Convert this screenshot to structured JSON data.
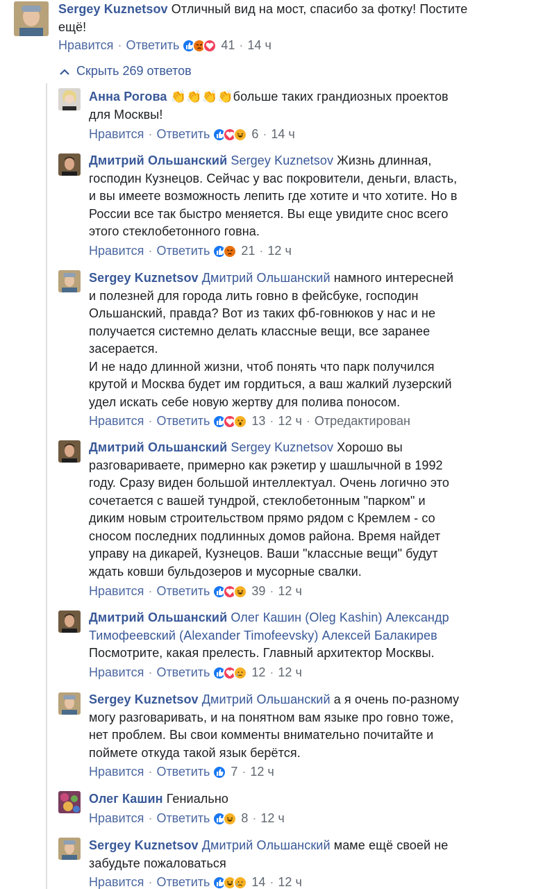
{
  "top_comment": {
    "author": "Sergey Kuznetsov",
    "lines": [
      "Отличный вид на мост, спасибо за фотку! Постите",
      "ещё!"
    ],
    "like_label": "Нравится",
    "reply_label": "Ответить",
    "reactions": [
      "like",
      "angry",
      "love"
    ],
    "count": "41",
    "time": "14 ч"
  },
  "toggle": {
    "label": "Скрыть 269 ответов"
  },
  "replies": [
    {
      "author": "Анна Рогова",
      "mention": "",
      "first_rest": "👏👏👏👏больше таких грандиозных проектов",
      "lines": [
        "для Москвы!"
      ],
      "like_label": "Нравится",
      "reply_label": "Ответить",
      "reactions": [
        "like",
        "love",
        "haha"
      ],
      "count": "6",
      "time": "14 ч",
      "edited": ""
    },
    {
      "author": "Дмитрий Ольшанский",
      "mention": "Sergey Kuznetsov",
      "first_rest": "Жизнь длинная,",
      "lines": [
        "господин Кузнецов. Сейчас у вас покровители, деньги, власть,",
        "и вы имеете возможность лепить где хотите и что хотите. Но в",
        "России все так быстро меняется. Вы еще увидите снос всего",
        "этого стеклобетонного говна."
      ],
      "like_label": "Нравится",
      "reply_label": "Ответить",
      "reactions": [
        "like",
        "angry"
      ],
      "count": "21",
      "time": "12 ч",
      "edited": ""
    },
    {
      "author": "Sergey Kuznetsov",
      "mention": "Дмитрий Ольшанский",
      "first_rest": "намного интересней",
      "lines": [
        "и полезней для города лить говно в фейсбуке, господин",
        "Ольшанский, правда? Вот из таких фб-говнюков у нас и не",
        "получается системно делать классные вещи, все заранее",
        "засерается.",
        "И не надо длинной жизни, чтоб понять что парк получился",
        "крутой и Москва будет им гордиться, а ваш жалкий лузерский",
        "удел искать себе новую жертву для полива поносом."
      ],
      "like_label": "Нравится",
      "reply_label": "Ответить",
      "reactions": [
        "like",
        "love",
        "wow"
      ],
      "count": "13",
      "time": "12 ч",
      "edited": "Отредактирован"
    },
    {
      "author": "Дмитрий Ольшанский",
      "mention": "Sergey Kuznetsov",
      "first_rest": "Хорошо вы",
      "lines": [
        "разговариваете, примерно как рэкетир у шашлычной в 1992",
        "году. Сразу виден большой интеллектуал. Очень логично это",
        "сочетается с вашей тундрой, стеклобетонным \"парком\" и",
        "диким новым строительством прямо рядом с Кремлем - со",
        "сносом последних подлинных домов района. Время найдет",
        "управу на дикарей, Кузнецов. Ваши \"классные вещи\" будут",
        "ждать ковши бульдозеров и мусорные свалки."
      ],
      "like_label": "Нравится",
      "reply_label": "Ответить",
      "reactions": [
        "like",
        "love",
        "haha"
      ],
      "count": "39",
      "time": "12 ч",
      "edited": ""
    },
    {
      "author": "Дмитрий Ольшанский",
      "mention": "Олег Кашин (Oleg Kashin) Александр",
      "mention_line2": "Тимофеевский (Alexander Timofeevsky) Алексей Балакирев",
      "first_rest": "",
      "lines": [
        "Посмотрите, какая прелесть. Главный архитектор Москвы."
      ],
      "like_label": "Нравится",
      "reply_label": "Ответить",
      "reactions": [
        "like",
        "love",
        "sad"
      ],
      "count": "12",
      "time": "12 ч",
      "edited": ""
    },
    {
      "author": "Sergey Kuznetsov",
      "mention": "Дмитрий Ольшанский",
      "first_rest": "а я очень по-разному",
      "lines": [
        "могу разговаривать, и на понятном вам языке про говно тоже,",
        "нет проблем. Вы свои комменты внимательно почитайте и",
        "поймете откуда такой язык берётся."
      ],
      "like_label": "Нравится",
      "reply_label": "Ответить",
      "reactions": [
        "like"
      ],
      "count": "7",
      "time": "12 ч",
      "edited": ""
    },
    {
      "author": "Олег Кашин",
      "mention": "",
      "first_rest": "Гениально",
      "lines": [],
      "like_label": "Нравится",
      "reply_label": "Ответить",
      "reactions": [
        "like",
        "haha"
      ],
      "count": "8",
      "time": "12 ч",
      "edited": ""
    },
    {
      "author": "Sergey Kuznetsov",
      "mention": "Дмитрий Ольшанский",
      "first_rest": "маме ещё своей не",
      "lines": [
        "забудьте пожаловаться"
      ],
      "like_label": "Нравится",
      "reply_label": "Ответить",
      "reactions": [
        "like",
        "haha",
        "sad"
      ],
      "count": "14",
      "time": "12 ч",
      "edited": ""
    }
  ]
}
